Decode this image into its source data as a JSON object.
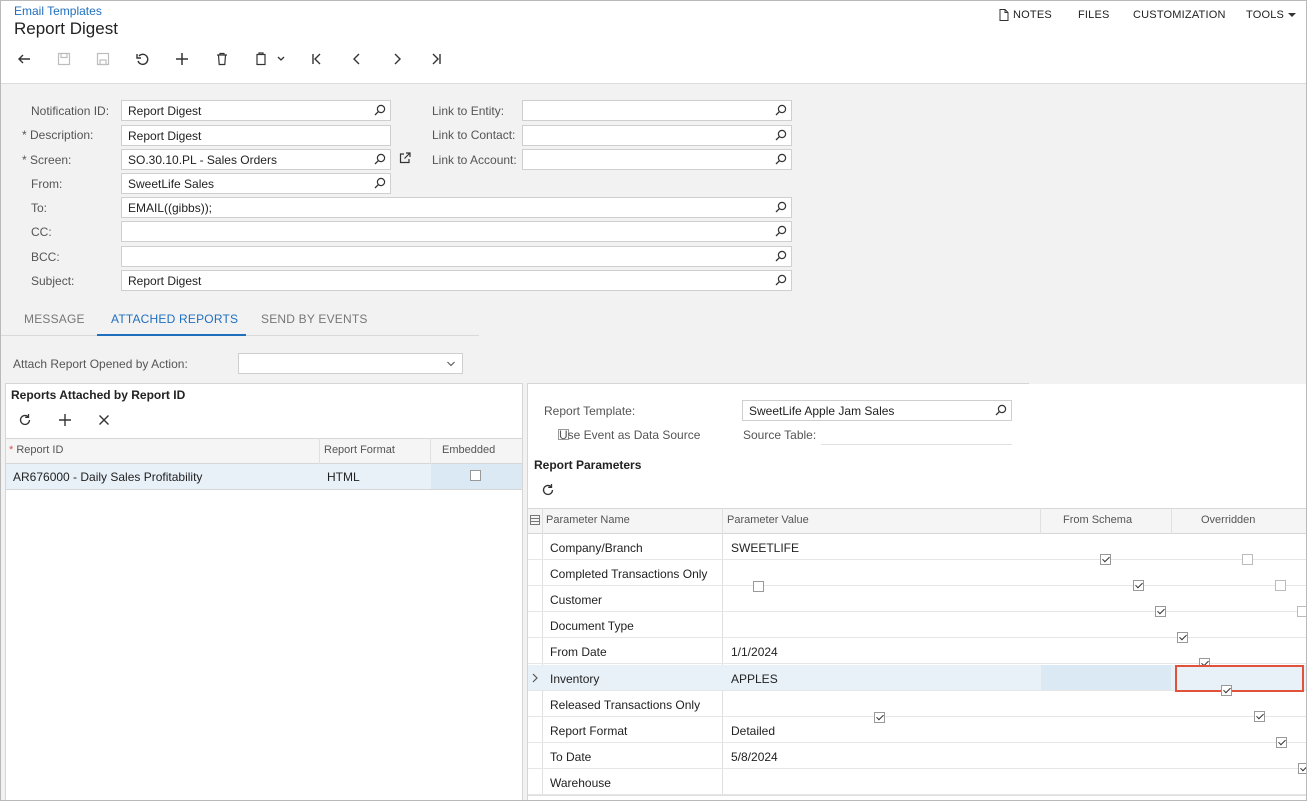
{
  "breadcrumb": "Email Templates",
  "page_title": "Report Digest",
  "top_menu": {
    "notes": "NOTES",
    "files": "FILES",
    "customization": "CUSTOMIZATION",
    "tools": "TOOLS"
  },
  "form": {
    "notification_id": {
      "label": "Notification ID:",
      "value": "Report Digest"
    },
    "description": {
      "label": "Description:",
      "value": "Report Digest"
    },
    "screen": {
      "label": "Screen:",
      "value": "SO.30.10.PL - Sales Orders"
    },
    "from": {
      "label": "From:",
      "value": "SweetLife Sales"
    },
    "to": {
      "label": "To:",
      "value": "EMAIL((gibbs));"
    },
    "cc": {
      "label": "CC:",
      "value": ""
    },
    "bcc": {
      "label": "BCC:",
      "value": ""
    },
    "subject": {
      "label": "Subject:",
      "value": "Report Digest"
    },
    "link_entity": {
      "label": "Link to Entity:",
      "value": ""
    },
    "link_contact": {
      "label": "Link to Contact:",
      "value": ""
    },
    "link_account": {
      "label": "Link to Account:",
      "value": ""
    }
  },
  "tabs": [
    "MESSAGE",
    "ATTACHED REPORTS",
    "SEND BY EVENTS"
  ],
  "attach_action": {
    "label": "Attach Report Opened by Action:",
    "value": ""
  },
  "reports_panel": {
    "title": "Reports Attached by Report ID",
    "columns": [
      "Report ID",
      "Report Format",
      "Embedded"
    ],
    "rows": [
      {
        "report_id": "AR676000 - Daily Sales Profitability",
        "format": "HTML",
        "embedded": false
      }
    ]
  },
  "details": {
    "report_template_label": "Report Template:",
    "report_template_value": "SweetLife Apple Jam Sales",
    "use_event_label": "Use Event as Data Source",
    "source_table_label": "Source Table:",
    "params_title": "Report Parameters",
    "columns": [
      "Parameter Name",
      "Parameter Value",
      "From Schema",
      "Overridden"
    ],
    "rows": [
      {
        "name": "Company/Branch",
        "value": "SWEETLIFE",
        "value_type": "text",
        "from_schema": true,
        "overridden": false
      },
      {
        "name": "Completed Transactions Only",
        "value": "",
        "value_type": "checkbox-off",
        "from_schema": true,
        "overridden": false
      },
      {
        "name": "Customer",
        "value": "",
        "value_type": "text",
        "from_schema": true,
        "overridden": false
      },
      {
        "name": "Document Type",
        "value": "",
        "value_type": "text",
        "from_schema": true,
        "overridden": false
      },
      {
        "name": "From Date",
        "value": "1/1/2024",
        "value_type": "text",
        "from_schema": true,
        "overridden": false
      },
      {
        "name": "Inventory",
        "value": "APPLES",
        "value_type": "text",
        "from_schema": true,
        "overridden": true
      },
      {
        "name": "Released Transactions Only",
        "value": "",
        "value_type": "checkbox-on",
        "from_schema": true,
        "overridden": false
      },
      {
        "name": "Report Format",
        "value": "Detailed",
        "value_type": "text",
        "from_schema": true,
        "overridden": false
      },
      {
        "name": "To Date",
        "value": "5/8/2024",
        "value_type": "text",
        "from_schema": true,
        "overridden": false
      },
      {
        "name": "Warehouse",
        "value": "",
        "value_type": "text",
        "from_schema": true,
        "overridden": false
      }
    ]
  },
  "colors": {
    "accent": "#1f6fbf",
    "highlight_row": "#dbe9f5",
    "focus_border": "#e0533a"
  }
}
